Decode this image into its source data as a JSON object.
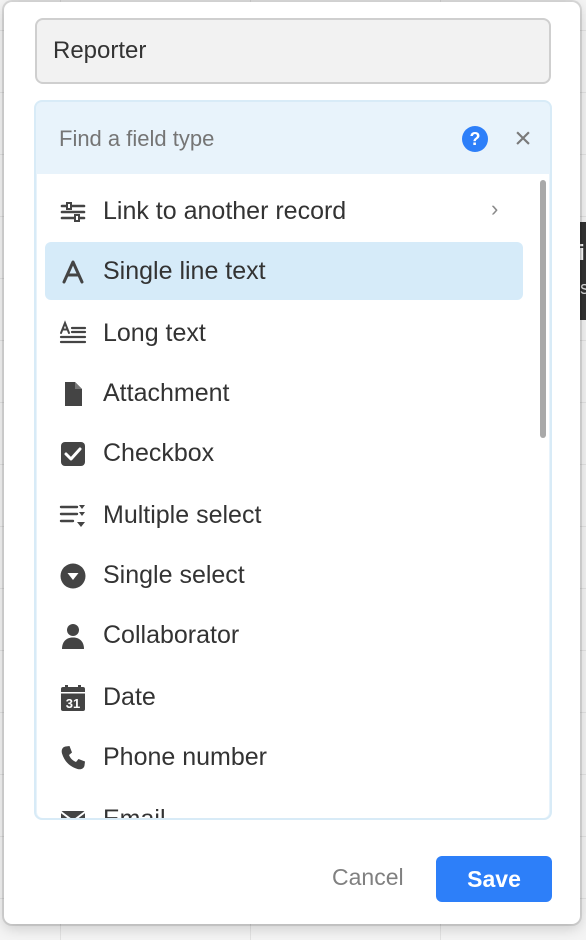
{
  "field": {
    "name_value": "Reporter"
  },
  "picker": {
    "search_placeholder": "Find a field type",
    "help_icon": "?",
    "close_icon": "×",
    "items": [
      {
        "label": "Link to another record",
        "icon": "link-record-icon",
        "has_submenu": true,
        "chevron": "›"
      },
      {
        "label": "Single line text",
        "icon": "single-line-text-icon",
        "selected": true
      },
      {
        "label": "Long text",
        "icon": "long-text-icon"
      },
      {
        "label": "Attachment",
        "icon": "attachment-icon"
      },
      {
        "label": "Checkbox",
        "icon": "checkbox-icon"
      },
      {
        "label": "Multiple select",
        "icon": "multiple-select-icon"
      },
      {
        "label": "Single select",
        "icon": "single-select-icon"
      },
      {
        "label": "Collaborator",
        "icon": "collaborator-icon"
      },
      {
        "label": "Date",
        "icon": "date-icon",
        "icon_text": "31"
      },
      {
        "label": "Phone number",
        "icon": "phone-icon"
      },
      {
        "label": "Email",
        "icon": "email-icon"
      }
    ]
  },
  "footer": {
    "cancel_label": "Cancel",
    "save_label": "Save"
  },
  "tooltip": {
    "title": "Si",
    "desc": "A s"
  },
  "colors": {
    "accent": "#2d7ff9",
    "selected_row": "#d6ebf9",
    "picker_bg": "#e8f3fb"
  }
}
